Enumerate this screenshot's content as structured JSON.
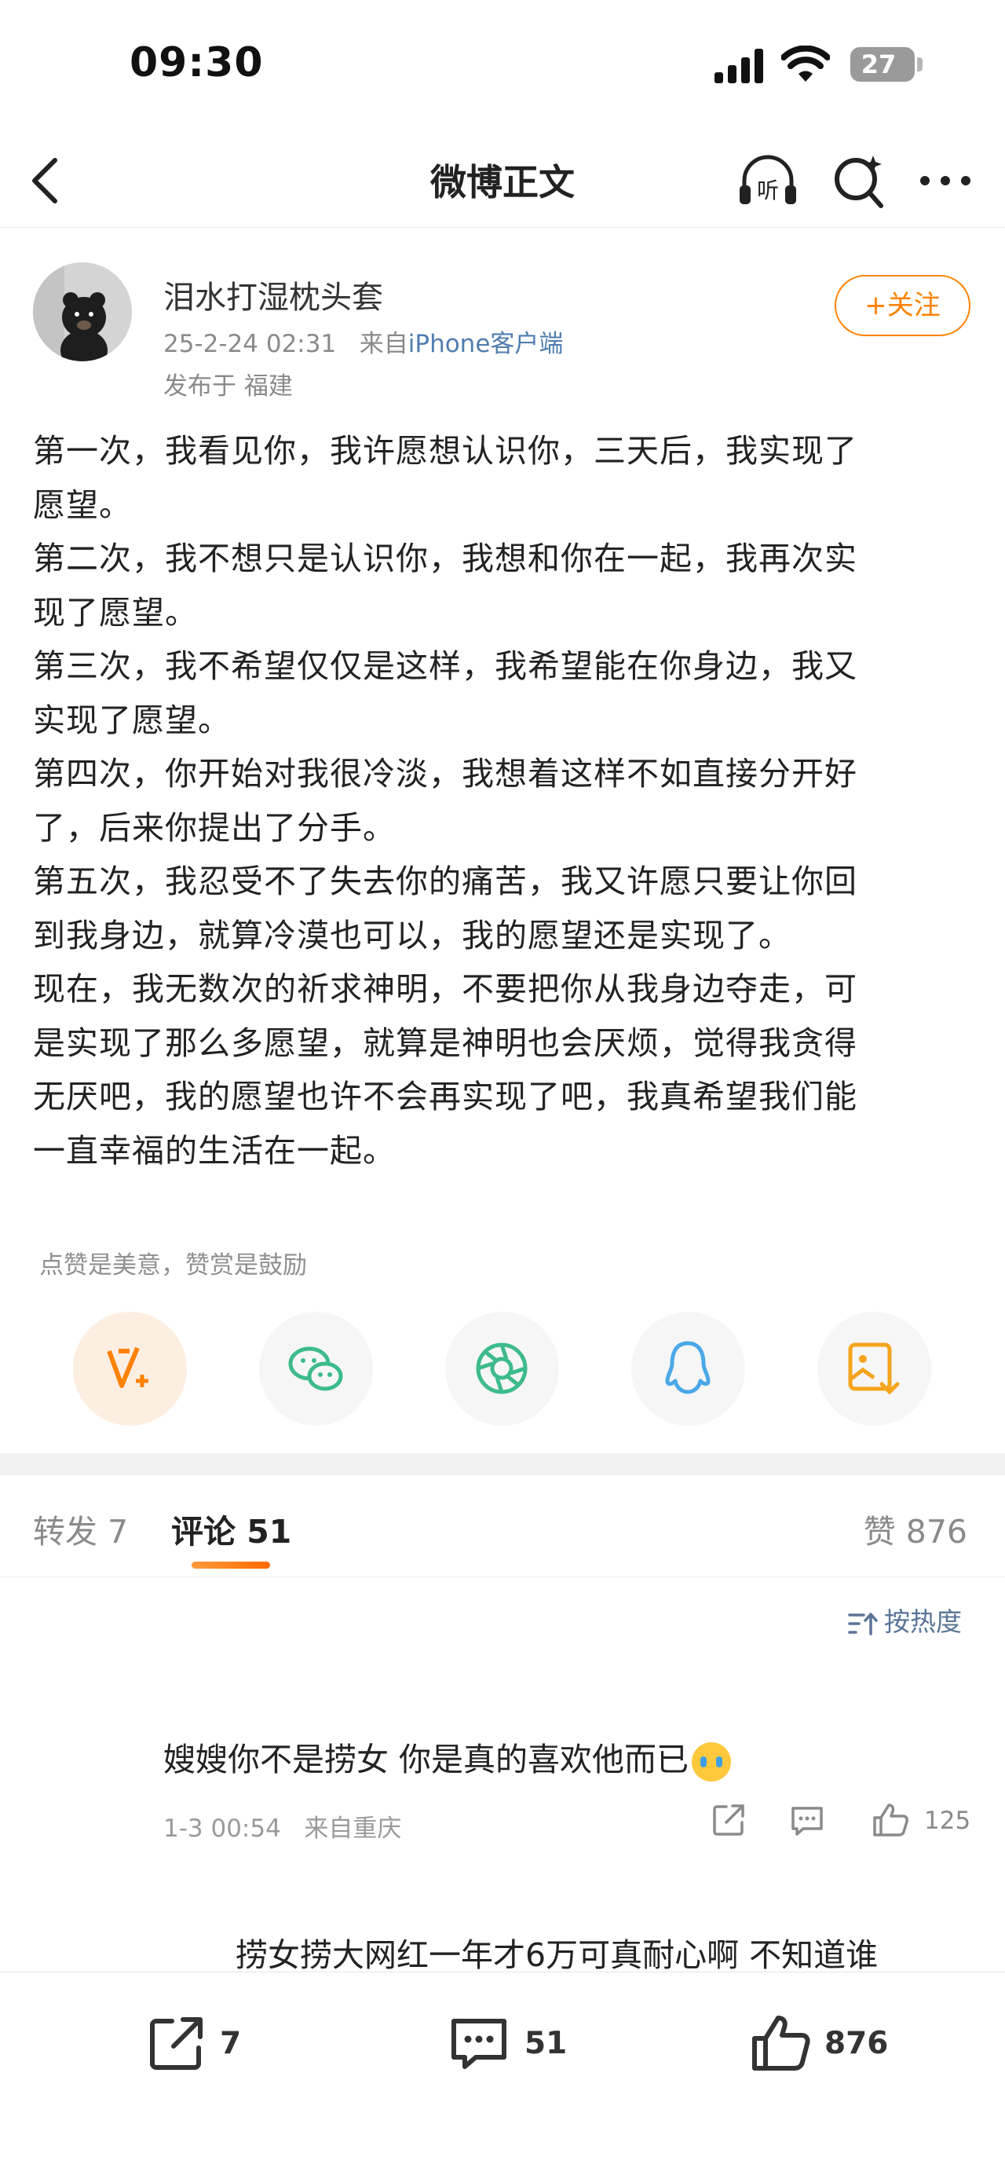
{
  "status_bar": {
    "time": "09:30",
    "battery": "27"
  },
  "nav": {
    "title": "微博正文"
  },
  "author": {
    "name": "泪水打湿枕头套",
    "date": "25-2-24 02:31",
    "source_prefix": "来自",
    "source": "iPhone客户端",
    "location": "发布于 福建",
    "follow_label": "+关注"
  },
  "post": {
    "lines": [
      "第一次，我看见你，我许愿想认识你，三天后，我实现了",
      "愿望。",
      "第二次，我不想只是认识你，我想和你在一起，我再次实",
      "现了愿望。",
      "第三次，我不希望仅仅是这样，我希望能在你身边，我又",
      "实现了愿望。",
      "第四次，你开始对我很冷淡，我想着这样不如直接分开好",
      "了，后来你提出了分手。",
      "第五次，我忍受不了失去你的痛苦，我又许愿只要让你回",
      "到我身边，就算冷漠也可以，我的愿望还是实现了。",
      "现在，我无数次的祈求神明，不要把你从我身边夺走，可",
      "是实现了那么多愿望，就算是神明也会厌烦，觉得我贪得",
      "无厌吧，我的愿望也许不会再实现了吧，我真希望我们能",
      "一直幸福的生活在一起。"
    ]
  },
  "reward": {
    "hint": "点赞是美意，赞赏是鼓励"
  },
  "share_icons": [
    "weibo-reward-icon",
    "wechat-icon",
    "moments-icon",
    "qq-icon",
    "save-image-icon"
  ],
  "tabs": {
    "repost": "转发 7",
    "comment": "评论 51",
    "like": "赞 876"
  },
  "sort": {
    "label": "按热度"
  },
  "comments": [
    {
      "text": "嫂嫂你不是捞女 你是真的喜欢他而已",
      "date": "1-3 00:54",
      "location": "来自重庆",
      "likes": "125"
    }
  ],
  "sub_comment": {
    "text": "捞女捞大网红一年才6万可真耐心啊 不知道谁"
  },
  "bottom_bar": {
    "reposts": "7",
    "comments": "51",
    "likes": "876"
  },
  "colors": {
    "accent": "#ff8200",
    "link": "#507daf",
    "sort": "#5a7496"
  }
}
